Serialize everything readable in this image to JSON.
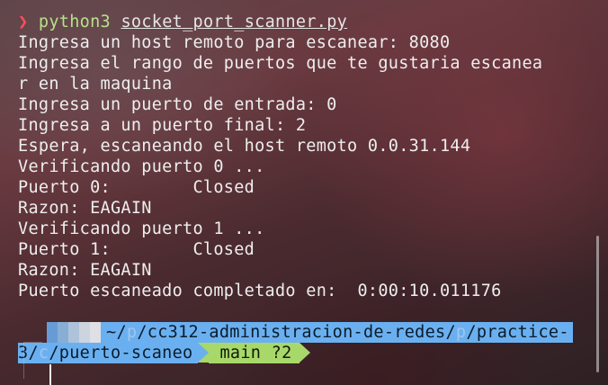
{
  "command": {
    "arrow": "❯",
    "program": "python3",
    "script": "socket_port_scanner.py"
  },
  "output": [
    "Ingresa un host remoto para escanear: 8080",
    "Ingresa el rango de puertos que te gustaria escanea",
    "r en la maquina",
    "Ingresa un puerto de entrada: 0",
    "Ingresa a un puerto final: 2",
    "Espera, escaneando el host remoto 0.0.31.144",
    "Verificando puerto 0 ...",
    "Puerto 0:        Closed",
    "Razon: EAGAIN",
    "Verificando puerto 1 ...",
    "Puerto 1:        Closed",
    "Razon: EAGAIN",
    "Puerto escaneado completado en:  0:00:10.011176"
  ],
  "prompt": {
    "path_line1_prefix": "~/",
    "path_p1": "p",
    "path_mid": "/cc312-administracion-de-redes/",
    "path_p2": "p",
    "path_end": "/practice-",
    "path_line2_start": "3/",
    "path_c": "c",
    "path_line2_end": "/puerto-scaneo",
    "git_branch": "main ?2"
  },
  "colors": {
    "prompt_arrow": "#ff4d5a",
    "command": "#b8e08a",
    "path_segment": "#6ab0f0",
    "git_segment": "#a8d86a",
    "text": "#eeeeee"
  }
}
